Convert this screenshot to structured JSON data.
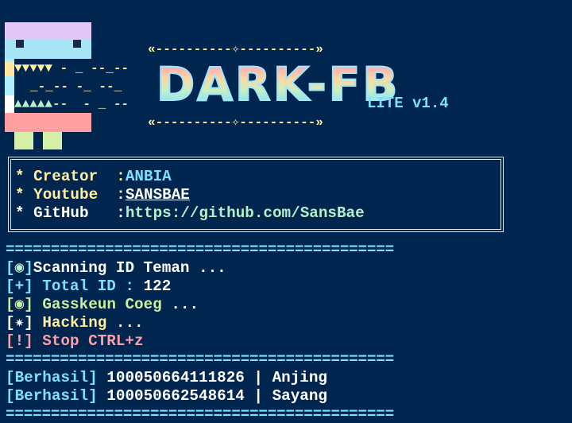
{
  "banner": {
    "deco_top": "«----------✧----------»",
    "deco_bottom": "«----------✧----------»",
    "squiggle1": "▼▼▼▼▼ - _ --_--",
    "squiggle2": "_-_-- -_ --_",
    "squiggle3": "▲▲▲▲▲--  - _ --",
    "logo_word": "DARK-FB",
    "version": "LITE v1.4"
  },
  "info": {
    "creator_label": "* Creator  :",
    "creator_value": "ANBIA",
    "youtube_label": "* Youtube  :",
    "youtube_value": "SANSBAE",
    "github_label": "* GitHub   :",
    "github_value": "https://github.com/SansBae"
  },
  "separator": "===========================================",
  "log": [
    {
      "prefix": "[",
      "mark": "◉",
      "suffix": "]",
      "text": "Scanning ID Teman ..."
    },
    {
      "prefix": "[+]",
      "text": " Total ID : ",
      "value": "122"
    },
    {
      "prefix": "[",
      "mark": "◉",
      "suffix": "]",
      "text": " Gasskeun Coeg ",
      "tail": "..."
    },
    {
      "prefix": "[",
      "mark": "✷",
      "suffix": "]",
      "text": " Hacking ",
      "tail": "..."
    },
    {
      "prefix": "[!]",
      "text": " Stop CTRL+z"
    }
  ],
  "results": [
    {
      "status": "[Berhasil]",
      "id": "100050664111826",
      "name": "Anjing"
    },
    {
      "status": "[Berhasil]",
      "id": "100050662548614",
      "name": "Sayang"
    }
  ],
  "colors": {
    "background": "#002650",
    "cyan": "#7fdfff",
    "yellow": "#ffef9f",
    "pink": "#ff9fa8",
    "green": "#c8f0a0"
  }
}
